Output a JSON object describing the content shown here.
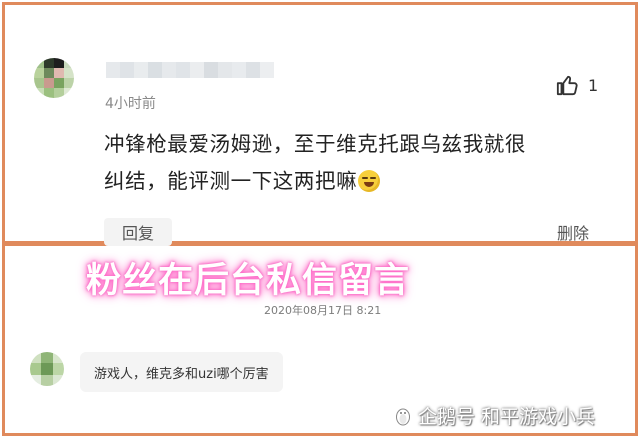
{
  "comment": {
    "time": "4小时前",
    "like_count": "1",
    "text_line1": "冲锋枪最爱汤姆逊，至于维克托跟乌兹我就很",
    "text_line2": "纠结，能评测一下这两把嘛",
    "reply_label": "回复",
    "delete_label": "删除"
  },
  "overlay": {
    "title": "粉丝在后台私信留言"
  },
  "private_message": {
    "timestamp": "2020年08月17日 8:21",
    "text": "游戏人，维克多和uzi哪个厉害"
  },
  "watermark": {
    "text": "企鹅号 和平游戏小兵"
  },
  "colors": {
    "panel_border": "#e08a5c",
    "overlay_glow": "#ff69c8"
  },
  "icons": [
    "thumbs-up-icon",
    "laughing-emoji-icon",
    "penguin-logo-icon"
  ]
}
